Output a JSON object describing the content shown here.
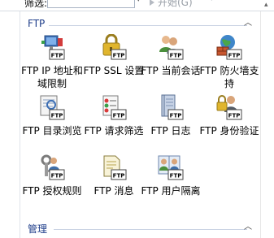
{
  "filter": {
    "label": "筛选:",
    "start_label": "开始(G)"
  },
  "groups": [
    {
      "title": "FTP",
      "items": [
        {
          "label": "FTP IP 地址和域限制",
          "icon": "network-monitor-icon"
        },
        {
          "label": "FTP SSL 设置",
          "icon": "padlock-icon"
        },
        {
          "label": "FTP 当前会话",
          "icon": "users-session-icon"
        },
        {
          "label": "FTP 防火墙支持",
          "icon": "firewall-globe-icon"
        },
        {
          "label": "FTP 目录浏览",
          "icon": "directory-browse-icon"
        },
        {
          "label": "FTP 请求筛选",
          "icon": "request-filter-icon"
        },
        {
          "label": "FTP 日志",
          "icon": "log-book-icon"
        },
        {
          "label": "FTP 身份验证",
          "icon": "user-key-icon"
        },
        {
          "label": "FTP 授权规则",
          "icon": "authorization-key-icon"
        },
        {
          "label": "FTP 消息",
          "icon": "message-document-icon"
        },
        {
          "label": "FTP 用户隔离",
          "icon": "user-isolation-icon"
        }
      ]
    },
    {
      "title": "管理"
    }
  ],
  "ftp_badge": "FTP",
  "colors": {
    "group_title": "#1e3d8a",
    "badge_border": "#444444"
  }
}
